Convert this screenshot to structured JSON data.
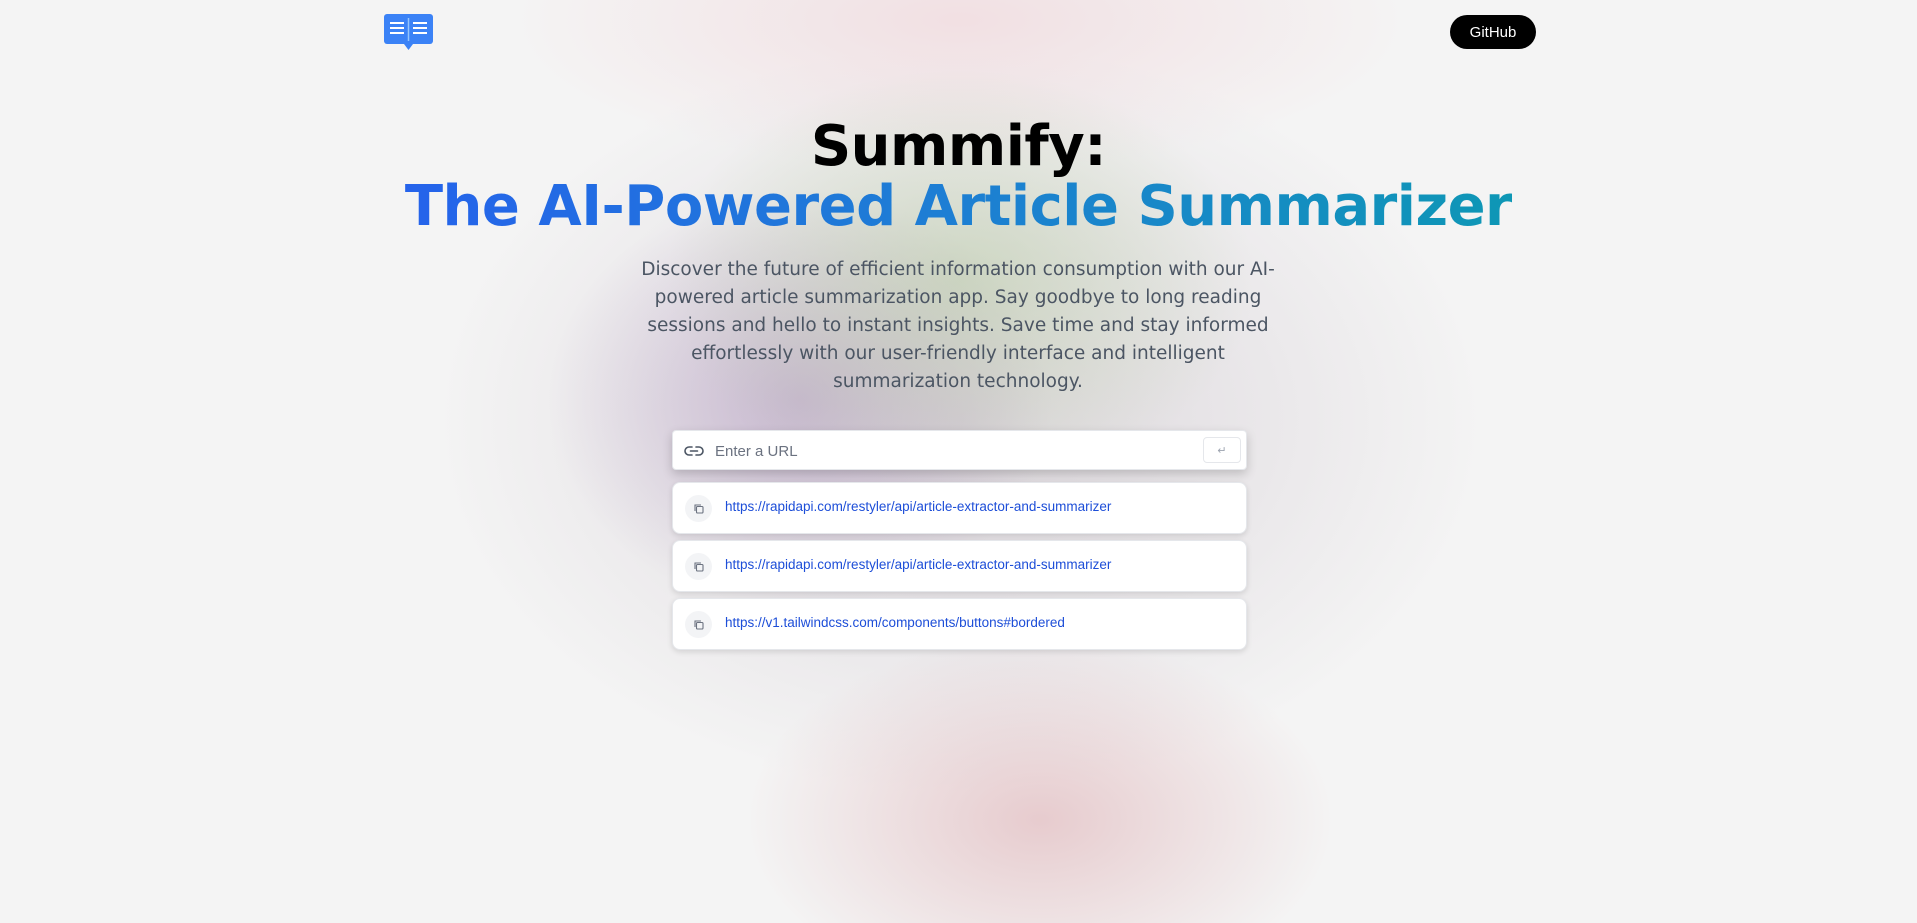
{
  "header": {
    "logo_icon": "open-book-icon",
    "github_label": "GitHub"
  },
  "hero": {
    "title_line1": "Summify:",
    "title_line2": "The AI-Powered Article Summarizer",
    "description": "Discover the future of efficient information consumption with our AI-powered article summarization app. Say goodbye to long reading sessions and hello to instant insights. Save time and stay informed effortlessly with our user-friendly interface and intelligent summarization technology."
  },
  "search": {
    "icon": "link-icon",
    "placeholder": "Enter a URL",
    "value": "",
    "submit_label": "↵"
  },
  "history": [
    {
      "url": "https://rapidapi.com/restyler/api/article-extractor-and-summarizer",
      "icon": "copy-icon"
    },
    {
      "url": "https://rapidapi.com/restyler/api/article-extractor-and-summarizer",
      "icon": "copy-icon"
    },
    {
      "url": "https://v1.tailwindcss.com/components/buttons#bordered",
      "icon": "copy-icon"
    }
  ],
  "colors": {
    "accent_blue": "#2563eb",
    "accent_teal": "#0e97b5",
    "link": "#1d4ed8",
    "button_bg": "#000000"
  }
}
